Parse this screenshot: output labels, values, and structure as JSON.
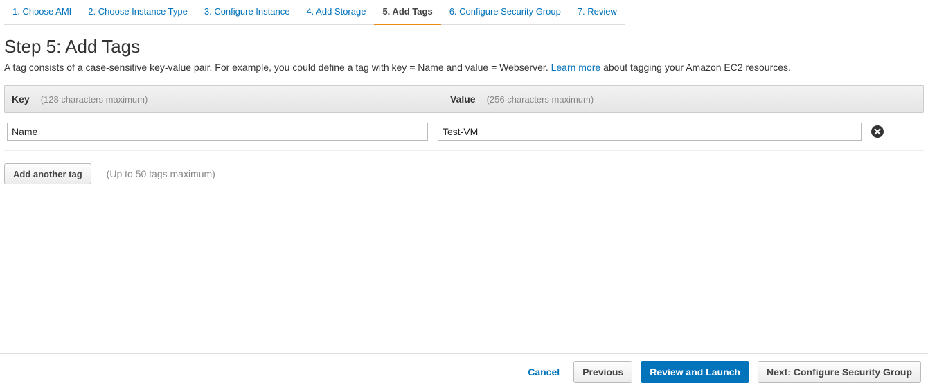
{
  "wizard": {
    "steps": [
      {
        "label": "1. Choose AMI"
      },
      {
        "label": "2. Choose Instance Type"
      },
      {
        "label": "3. Configure Instance"
      },
      {
        "label": "4. Add Storage"
      },
      {
        "label": "5. Add Tags",
        "active": true
      },
      {
        "label": "6. Configure Security Group"
      },
      {
        "label": "7. Review"
      }
    ]
  },
  "page": {
    "title": "Step 5: Add Tags",
    "desc_pre": "A tag consists of a case-sensitive key-value pair. For example, you could define a tag with key = Name and value = Webserver. ",
    "learn_more": "Learn more",
    "desc_post": " about tagging your Amazon EC2 resources."
  },
  "columns": {
    "key_label": "Key",
    "key_hint": "(128 characters maximum)",
    "value_label": "Value",
    "value_hint": "(256 characters maximum)"
  },
  "tags": [
    {
      "key": "Name",
      "value": "Test-VM"
    }
  ],
  "add": {
    "button": "Add another tag",
    "hint": "(Up to 50 tags maximum)"
  },
  "footer": {
    "cancel": "Cancel",
    "previous": "Previous",
    "review": "Review and Launch",
    "next": "Next: Configure Security Group"
  }
}
